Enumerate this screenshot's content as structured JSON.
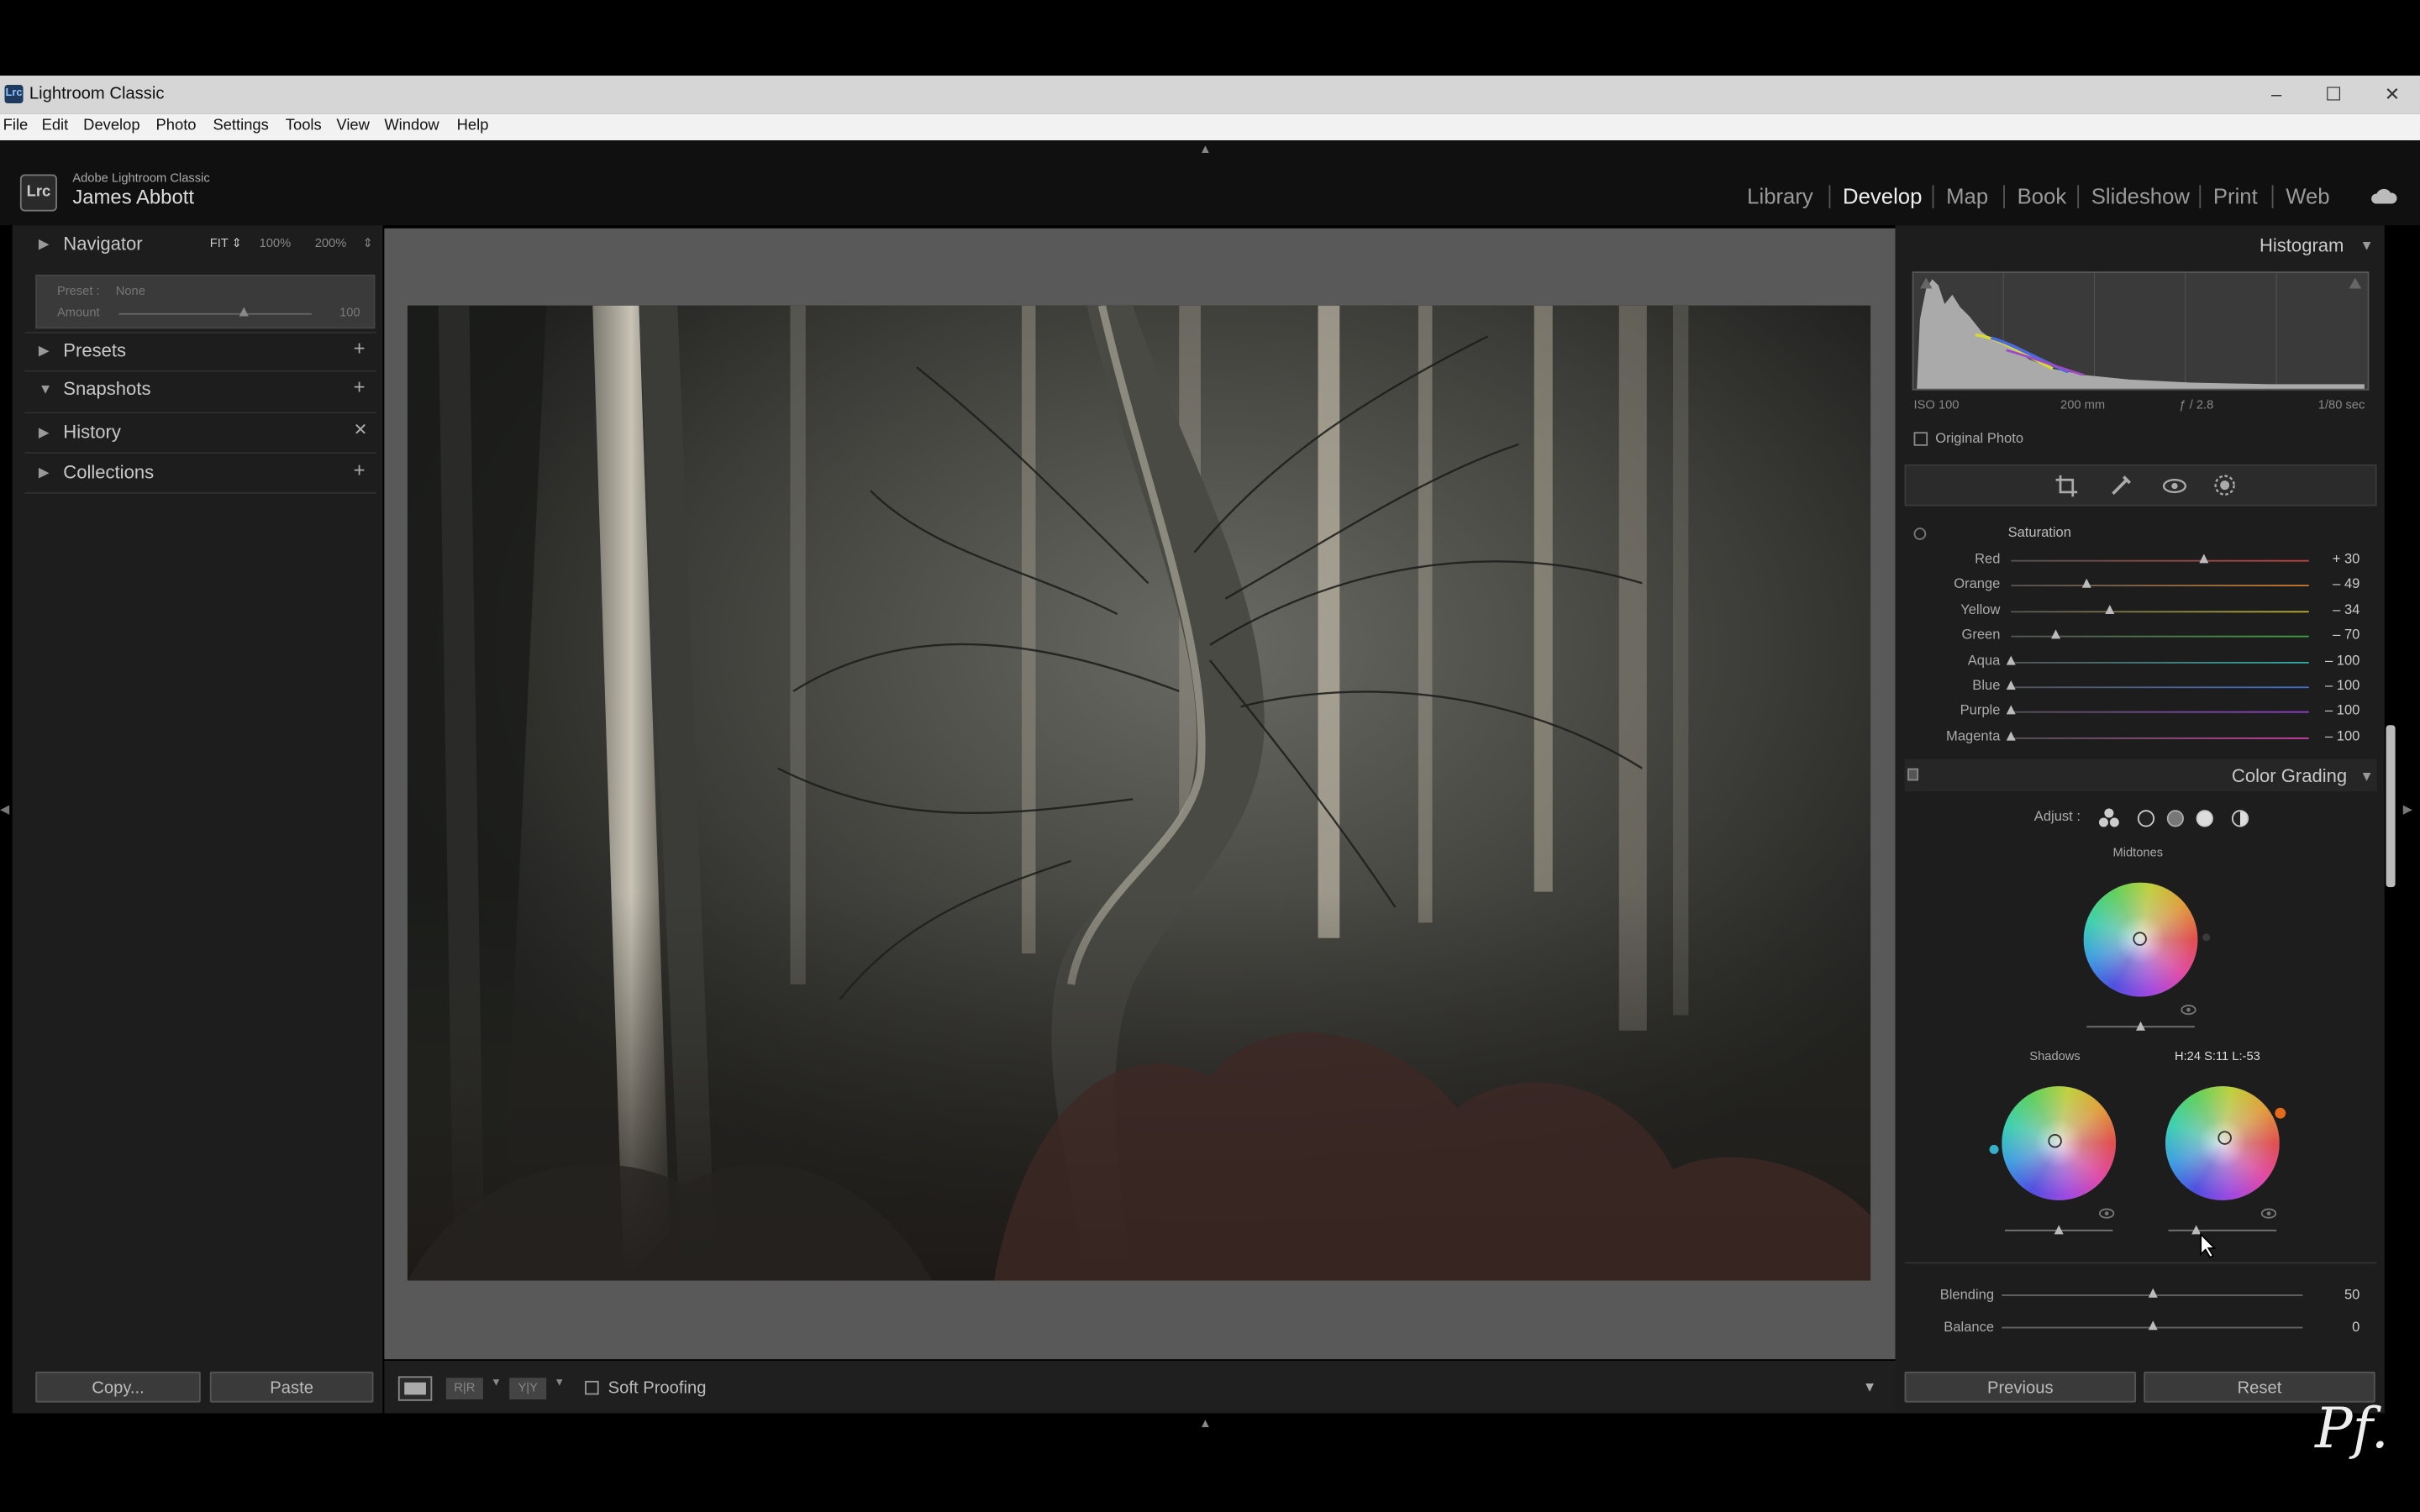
{
  "window": {
    "title": "Lightroom Classic",
    "logo_text": "Lrc",
    "minimize": "–",
    "maximize": "☐",
    "close": "✕"
  },
  "menu": [
    "File",
    "Edit",
    "Develop",
    "Photo",
    "Settings",
    "Tools",
    "View",
    "Window",
    "Help"
  ],
  "identity": {
    "logo_text": "Lrc",
    "brand": "Adobe Lightroom Classic",
    "user": "James Abbott"
  },
  "modules": [
    "Library",
    "Develop",
    "Map",
    "Book",
    "Slideshow",
    "Print",
    "Web"
  ],
  "active_module": "Develop",
  "left_panel": {
    "navigator": {
      "title": "Navigator",
      "fit": "FIT ⇕",
      "z100": "100%",
      "z200": "200%",
      "more": "⇕"
    },
    "preset": {
      "label": "Preset :",
      "value": "None",
      "amount_label": "Amount",
      "amount_value": "100",
      "amount_fraction": 0.65
    },
    "sections": [
      {
        "title": "Presets",
        "action": "+"
      },
      {
        "title": "Snapshots",
        "action": "+"
      },
      {
        "title": "History",
        "action": "✕"
      },
      {
        "title": "Collections",
        "action": "+"
      }
    ],
    "copy_button": "Copy...",
    "paste_button": "Paste"
  },
  "toolbar": {
    "soft_proofing": "Soft Proofing",
    "compare1": "R|R",
    "compare2": "Y|Y"
  },
  "right_panel": {
    "histogram": {
      "title": "Histogram",
      "iso": "ISO 100",
      "focal": "200 mm",
      "aperture": "ƒ / 2.8",
      "shutter": "1/80 sec",
      "original_photo": "Original Photo"
    },
    "saturation": {
      "title": "Saturation",
      "items": [
        {
          "label": "Red",
          "value": "+ 30",
          "num": 30,
          "color": "#c94040"
        },
        {
          "label": "Orange",
          "value": "– 49",
          "num": -49,
          "color": "#c97a30"
        },
        {
          "label": "Yellow",
          "value": "– 34",
          "num": -34,
          "color": "#b9b030"
        },
        {
          "label": "Green",
          "value": "– 70",
          "num": -70,
          "color": "#40a040"
        },
        {
          "label": "Aqua",
          "value": "– 100",
          "num": -100,
          "color": "#30a9a9"
        },
        {
          "label": "Blue",
          "value": "– 100",
          "num": -100,
          "color": "#3f6fcf"
        },
        {
          "label": "Purple",
          "value": "– 100",
          "num": -100,
          "color": "#8f40cf"
        },
        {
          "label": "Magenta",
          "value": "– 100",
          "num": -100,
          "color": "#cf40a9"
        }
      ]
    },
    "color_grading": {
      "title": "Color Grading",
      "adjust_label": "Adjust :",
      "midtones": "Midtones",
      "shadows": "Shadows",
      "readout": "H:24 S:11 L:-53",
      "blending_label": "Blending",
      "blending_value": "50",
      "blending_fraction": 0.5,
      "balance_label": "Balance",
      "balance_value": "0",
      "balance_fraction": 0.5
    },
    "previous_button": "Previous",
    "reset_button": "Reset"
  },
  "watermark": "Pf."
}
